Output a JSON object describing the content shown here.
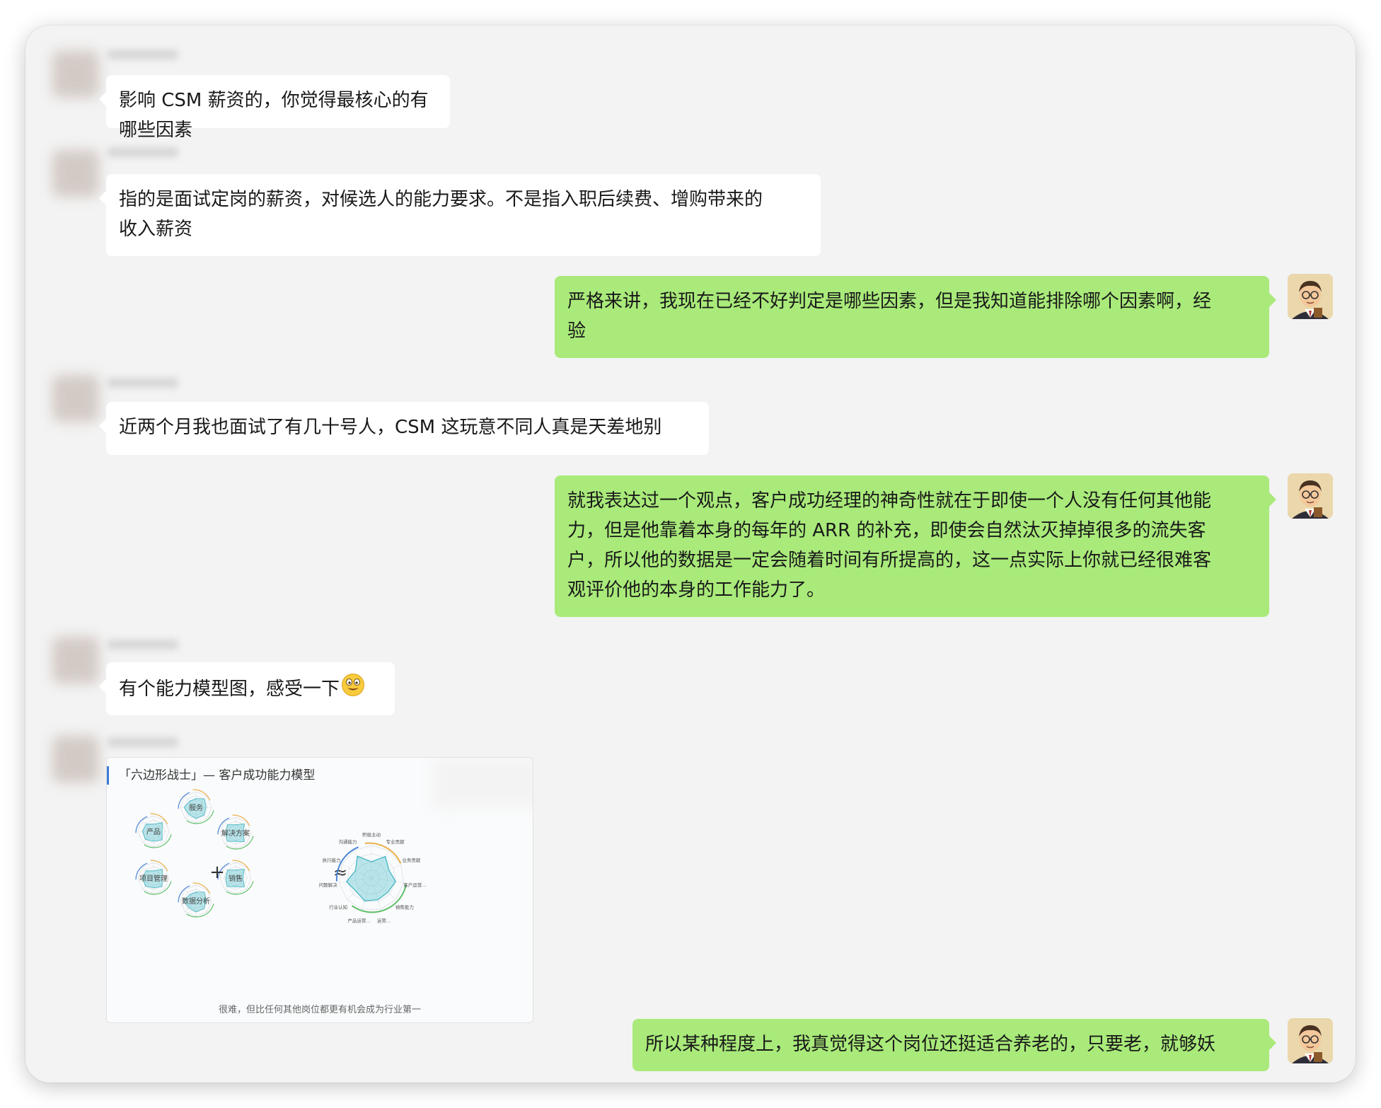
{
  "messages": [
    {
      "side": "left",
      "text": "影响 CSM 薪资的，你觉得最核心的有哪些因素"
    },
    {
      "side": "left",
      "lines": [
        "指的是面试定岗的薪资，对候选人的能力要求。不是指入职后续费、增购带来的",
        "收入薪资"
      ]
    },
    {
      "side": "right",
      "lines": [
        "严格来讲，我现在已经不好判定是哪些因素，但是我知道能排除哪个因素啊，经",
        "验"
      ]
    },
    {
      "side": "left",
      "text": "近两个月我也面试了有几十号人，CSM 这玩意不同人真是天差地别"
    },
    {
      "side": "right",
      "lines": [
        "就我表达过一个观点，客户成功经理的神奇性就在于即使一个人没有任何其他能",
        "力，但是他靠着本身的每年的 ARR 的补充，即使会自然汰灭掉掉很多的流失客",
        "户，所以他的数据是一定会随着时间有所提高的，这一点实际上你就已经很难客",
        "观评价他的本身的工作能力了。"
      ]
    },
    {
      "side": "left",
      "text": "有个能力模型图，感受一下",
      "emoji": "grinning-face-icon"
    },
    {
      "side": "right",
      "text": "所以某种程度上，我真觉得这个岗位还挺适合养老的，只要老，就够妖"
    }
  ],
  "image_card": {
    "title": "「六边形战士」— 客户成功能力模型",
    "plus": "+",
    "approx": "≈",
    "small_radars": [
      "服务",
      "产品",
      "解决方案",
      "项目管理",
      "销售",
      "数据分析"
    ],
    "big_radar_labels": [
      "积极主动",
      "专业贡献",
      "业务贡献",
      "客户运营...",
      "销售能力",
      "运营...",
      "产品运营...",
      "行业认知",
      "问题解决",
      "执行能力",
      "沟通能力"
    ],
    "caption": "很难，但比任何其他岗位都更有机会成为行业第一"
  },
  "colors": {
    "right_bubble": "#a9ea7a",
    "left_bubble": "#ffffff",
    "background": "#f3f3f3"
  }
}
